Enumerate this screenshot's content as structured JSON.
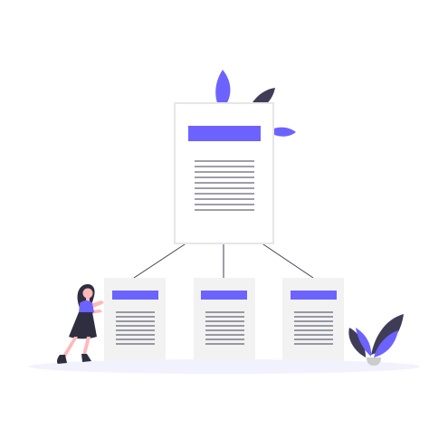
{
  "illustration": {
    "subject": "document-hierarchy",
    "colors": {
      "accent": "#6c63ff",
      "dark": "#3f3d56",
      "page_fill": "#f2f2f2",
      "page_stroke": "#e6e6e6",
      "line": "#3f3d56",
      "ground": "#f2f1fe",
      "skin": "#ffb8b8",
      "hair": "#2f2e41"
    },
    "parent_document": {
      "icon": "document-icon"
    },
    "child_documents": [
      {
        "icon": "document-icon"
      },
      {
        "icon": "document-icon"
      },
      {
        "icon": "document-icon"
      }
    ],
    "person": {
      "icon": "woman-pushing-icon"
    },
    "plants": [
      "leaf-icon",
      "plant-icon"
    ]
  }
}
